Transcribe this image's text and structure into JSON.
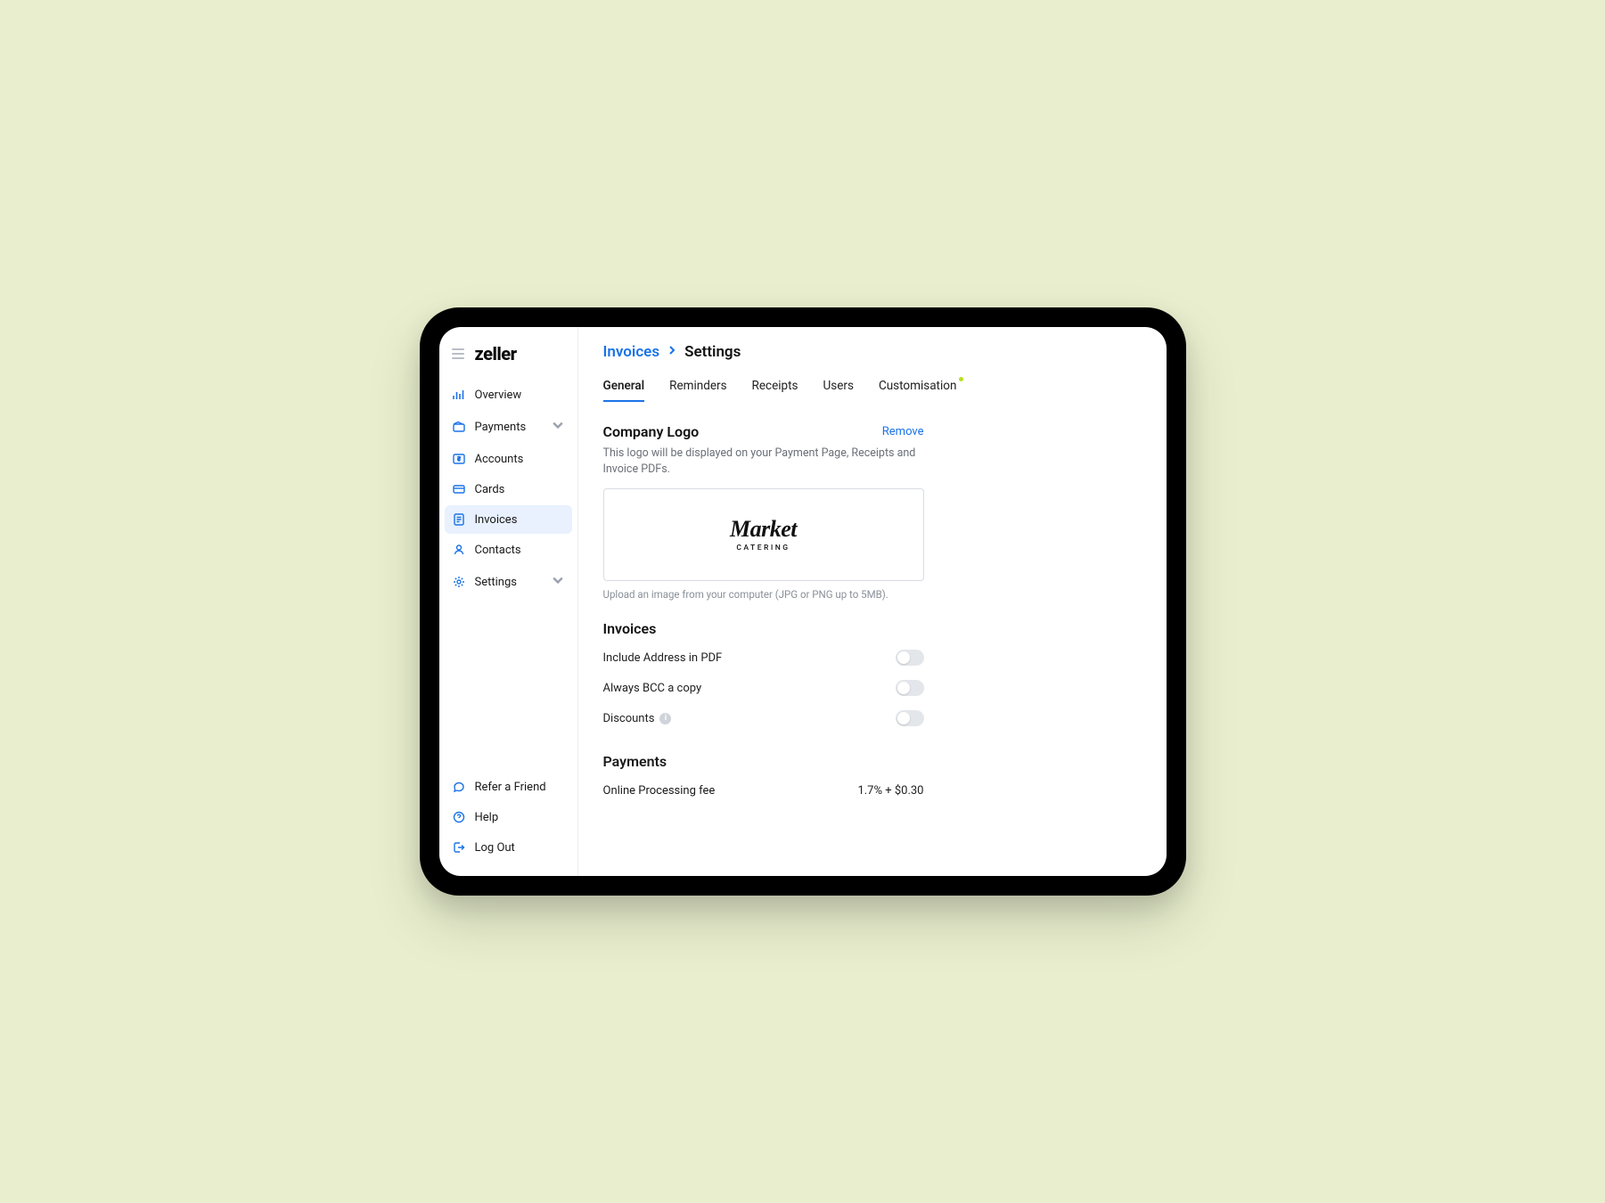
{
  "brand": "zeller",
  "sidebar": {
    "items": [
      {
        "label": "Overview",
        "icon": "bar-chart-icon"
      },
      {
        "label": "Payments",
        "icon": "wallet-icon",
        "expandable": true
      },
      {
        "label": "Accounts",
        "icon": "dollar-box-icon"
      },
      {
        "label": "Cards",
        "icon": "card-icon"
      },
      {
        "label": "Invoices",
        "icon": "invoice-icon",
        "active": true
      },
      {
        "label": "Contacts",
        "icon": "person-icon"
      },
      {
        "label": "Settings",
        "icon": "gear-icon",
        "expandable": true
      }
    ],
    "footer": [
      {
        "label": "Refer a Friend",
        "icon": "chat-icon"
      },
      {
        "label": "Help",
        "icon": "help-icon"
      },
      {
        "label": "Log Out",
        "icon": "logout-icon"
      }
    ]
  },
  "breadcrumb": {
    "parent": "Invoices",
    "current": "Settings"
  },
  "tabs": [
    {
      "label": "General",
      "active": true
    },
    {
      "label": "Reminders"
    },
    {
      "label": "Receipts"
    },
    {
      "label": "Users"
    },
    {
      "label": "Customisation",
      "dot": true
    }
  ],
  "logo_section": {
    "title": "Company Logo",
    "remove": "Remove",
    "description": "This logo will be displayed on your Payment Page, Receipts and Invoice PDFs.",
    "logo_name": "Market",
    "logo_tagline": "CATERING",
    "upload_hint": "Upload an image from your computer (JPG or PNG up to 5MB)."
  },
  "invoices_section": {
    "title": "Invoices",
    "rows": [
      {
        "label": "Include Address in PDF"
      },
      {
        "label": "Always BCC a copy"
      },
      {
        "label": "Discounts",
        "info": true
      }
    ]
  },
  "payments_section": {
    "title": "Payments",
    "rows": [
      {
        "label": "Online Processing fee",
        "value": "1.7% + $0.30"
      }
    ]
  }
}
